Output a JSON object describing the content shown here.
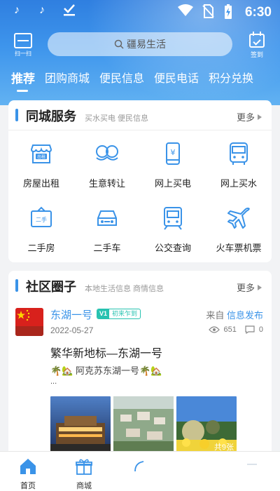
{
  "status_bar": {
    "time": "6:30"
  },
  "header": {
    "scan_label": "扫一扫",
    "search_placeholder": "疆易生活",
    "signin_label": "签到"
  },
  "tabs": [
    "推荐",
    "团购商城",
    "便民信息",
    "便民电话",
    "积分兑换"
  ],
  "city_service": {
    "title": "同城服务",
    "subtitle": "买水买电 便民信息",
    "more": "更多",
    "items": [
      {
        "label": "房屋出租",
        "icon": "shop-icon"
      },
      {
        "label": "生意转让",
        "icon": "mustache-icon"
      },
      {
        "label": "网上买电",
        "icon": "phone-yuan-icon"
      },
      {
        "label": "网上买水",
        "icon": "bus-icon"
      },
      {
        "label": "二手房",
        "icon": "secondhand-sign-icon"
      },
      {
        "label": "二手车",
        "icon": "car-icon"
      },
      {
        "label": "公交查询",
        "icon": "train-icon"
      },
      {
        "label": "火车票机票",
        "icon": "plane-icon"
      }
    ],
    "shop_sign": "出租",
    "secondhand_sign": "二手"
  },
  "community": {
    "title": "社区圈子",
    "subtitle": "本地生活信息 商情信息",
    "more": "更多",
    "post": {
      "author": "东湖一号",
      "badge_v": "V1",
      "badge_text": "初来乍到",
      "from_prefix": "来自",
      "from_source": "信息发布",
      "date": "2022-05-27",
      "views": "651",
      "comments": "0",
      "title": "繁华新地标—东湖一号",
      "text": "🌴🏡 阿克苏东湖一号🌴🏡",
      "ellipsis": "...",
      "image_count": "共9张"
    }
  },
  "bottom_nav": [
    {
      "label": "首页",
      "active": true
    },
    {
      "label": "商城",
      "active": false
    },
    {
      "label": "",
      "active": false
    },
    {
      "label": "",
      "active": false
    },
    {
      "label": "",
      "active": false
    }
  ],
  "colors": {
    "accent": "#3a93e8",
    "header": "#3e95ec",
    "badge": "#27c2b0"
  }
}
